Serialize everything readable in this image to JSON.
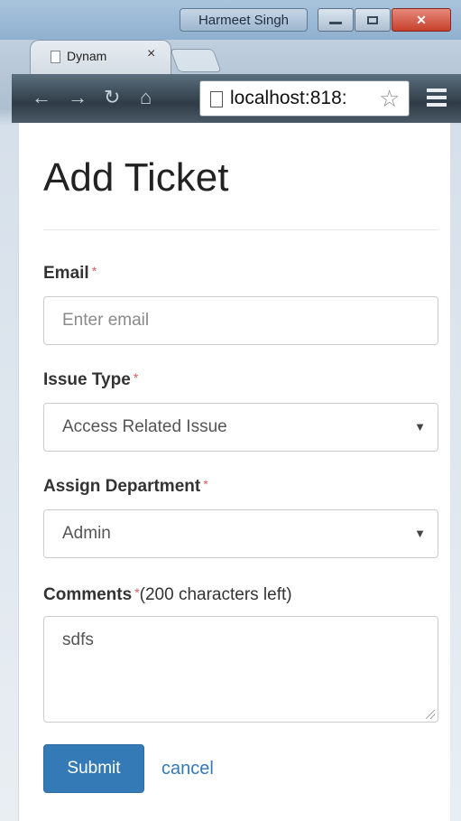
{
  "window": {
    "user_name": "Harmeet Singh",
    "tab_title": "Dynam",
    "url": "localhost:818:"
  },
  "form": {
    "title": "Add Ticket",
    "email": {
      "label": "Email",
      "required_mark": "*",
      "placeholder": "Enter email"
    },
    "issue_type": {
      "label": "Issue Type",
      "required_mark": "*",
      "selected": "Access Related Issue"
    },
    "department": {
      "label": "Assign Department",
      "required_mark": "*",
      "selected": "Admin"
    },
    "comments": {
      "label": "Comments",
      "required_mark": "*",
      "hint": "(200 characters left)",
      "value": "sdfs"
    },
    "submit_label": "Submit",
    "cancel_label": "cancel"
  },
  "colors": {
    "primary": "#337ab7",
    "required": "#e05c5c"
  }
}
